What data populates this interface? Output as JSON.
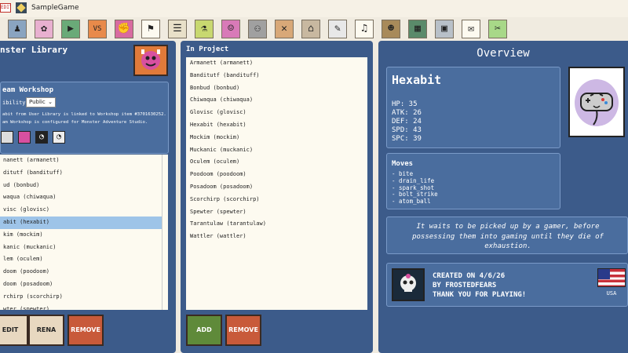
{
  "window": {
    "title": "SampleGame",
    "corner_label": "EDIT"
  },
  "toolbar": {
    "tools": [
      {
        "name": "avatar-tool",
        "glyph": "♟",
        "bg": "#8aa4c0"
      },
      {
        "name": "sprite-tool",
        "glyph": "✿",
        "bg": "#e8b0d0"
      },
      {
        "name": "play-tool",
        "glyph": "▶",
        "bg": "#6aaa78"
      },
      {
        "name": "versus-tool",
        "glyph": "VS",
        "bg": "#e88a4a"
      },
      {
        "name": "attack-tool",
        "glyph": "✊",
        "bg": "#d86aa0"
      },
      {
        "name": "runner-tool",
        "glyph": "⚑",
        "bg": "#fdfaf0"
      },
      {
        "name": "dialog-tool",
        "glyph": "☰",
        "bg": "#e8e0c8"
      },
      {
        "name": "potion-tool",
        "glyph": "⚗",
        "bg": "#c8d870"
      },
      {
        "name": "character-tool",
        "glyph": "☺",
        "bg": "#d87ab8"
      },
      {
        "name": "npc-tool",
        "glyph": "⚇",
        "bg": "#a0a0a0"
      },
      {
        "name": "settings-tool",
        "glyph": "✕",
        "bg": "#d8a878"
      },
      {
        "name": "shop-tool",
        "glyph": "⌂",
        "bg": "#c8b8a0"
      },
      {
        "name": "script-tool",
        "glyph": "✎",
        "bg": "#e8e8e8"
      },
      {
        "name": "music-tool",
        "glyph": "♫",
        "bg": "#fdfaf0"
      },
      {
        "name": "portrait-tool",
        "glyph": "☻",
        "bg": "#a88a5a"
      },
      {
        "name": "map-tool",
        "glyph": "▦",
        "bg": "#5a8a6a"
      },
      {
        "name": "window-tool",
        "glyph": "▣",
        "bg": "#b8c0c8"
      },
      {
        "name": "note-tool",
        "glyph": "✉",
        "bg": "#fdfaf0"
      },
      {
        "name": "tag-tool",
        "glyph": "✂",
        "bg": "#a8d888"
      }
    ]
  },
  "library": {
    "title": "nster Library",
    "workshop": {
      "title": "eam Workshop",
      "visibility_label": "ibility",
      "visibility_value": "Public",
      "info_line1": "abit from User Library is linked to Workshop item #3701630252.",
      "info_line2": "am Workshop is configured for Monster Adventure Studio."
    },
    "items": [
      "nanett (armanett)",
      "ditutf (bandituff)",
      "ud (bonbud)",
      "waqua (chiwaqua)",
      "visc (glovisc)",
      "abit (hexabit)",
      "kim (mockim)",
      "kanic (muckanic)",
      "lem (oculem)",
      "doom (poodoom)",
      "doom (posadoom)",
      "rchirp (scorchirp)",
      "wter (spewter)"
    ],
    "selected_index": 5,
    "buttons": {
      "edit": "EDIT",
      "rename": "RENA",
      "remove": "REMOVE"
    }
  },
  "project": {
    "title": "In Project",
    "items": [
      "Armanett (armanett)",
      "Banditutf (bandituff)",
      "Bonbud (bonbud)",
      "Chiwaqua (chiwaqua)",
      "Glovisc (glovisc)",
      "Hexabit (hexabit)",
      "Mockim (mockim)",
      "Muckanic (muckanic)",
      "Oculem (oculem)",
      "Poodoom (poodoom)",
      "Posadoom (posadoom)",
      "Scorchirp (scorchirp)",
      "Spewter (spewter)",
      "Tarantulaw (tarantulaw)",
      "Wattler (wattler)"
    ],
    "buttons": {
      "add": "ADD",
      "remove": "REMOVE"
    }
  },
  "overview": {
    "title": "Overview",
    "monster_name": "Hexabit",
    "stats": [
      "HP: 35",
      "ATK: 26",
      "DEF: 24",
      "SPD: 43",
      "SPC: 39"
    ],
    "moves_title": "Moves",
    "moves": [
      "- bite",
      "- drain_life",
      "- spark_shot",
      "- bolt_strike",
      "- atom_ball"
    ],
    "description": "It waits to be picked up by a gamer, before possessing them into gaming until they die of exhaustion.",
    "credits": [
      "CREATED ON 4/6/26",
      "BY FROSTEDFEARS",
      "THANK YOU FOR PLAYING!"
    ],
    "country": "USA"
  },
  "colors": {
    "panel": "#3c5b8a",
    "card": "#4a6d9e",
    "list_bg": "#fdfaf0",
    "selected": "#9ec4e8",
    "background": "#f0ebe0"
  }
}
